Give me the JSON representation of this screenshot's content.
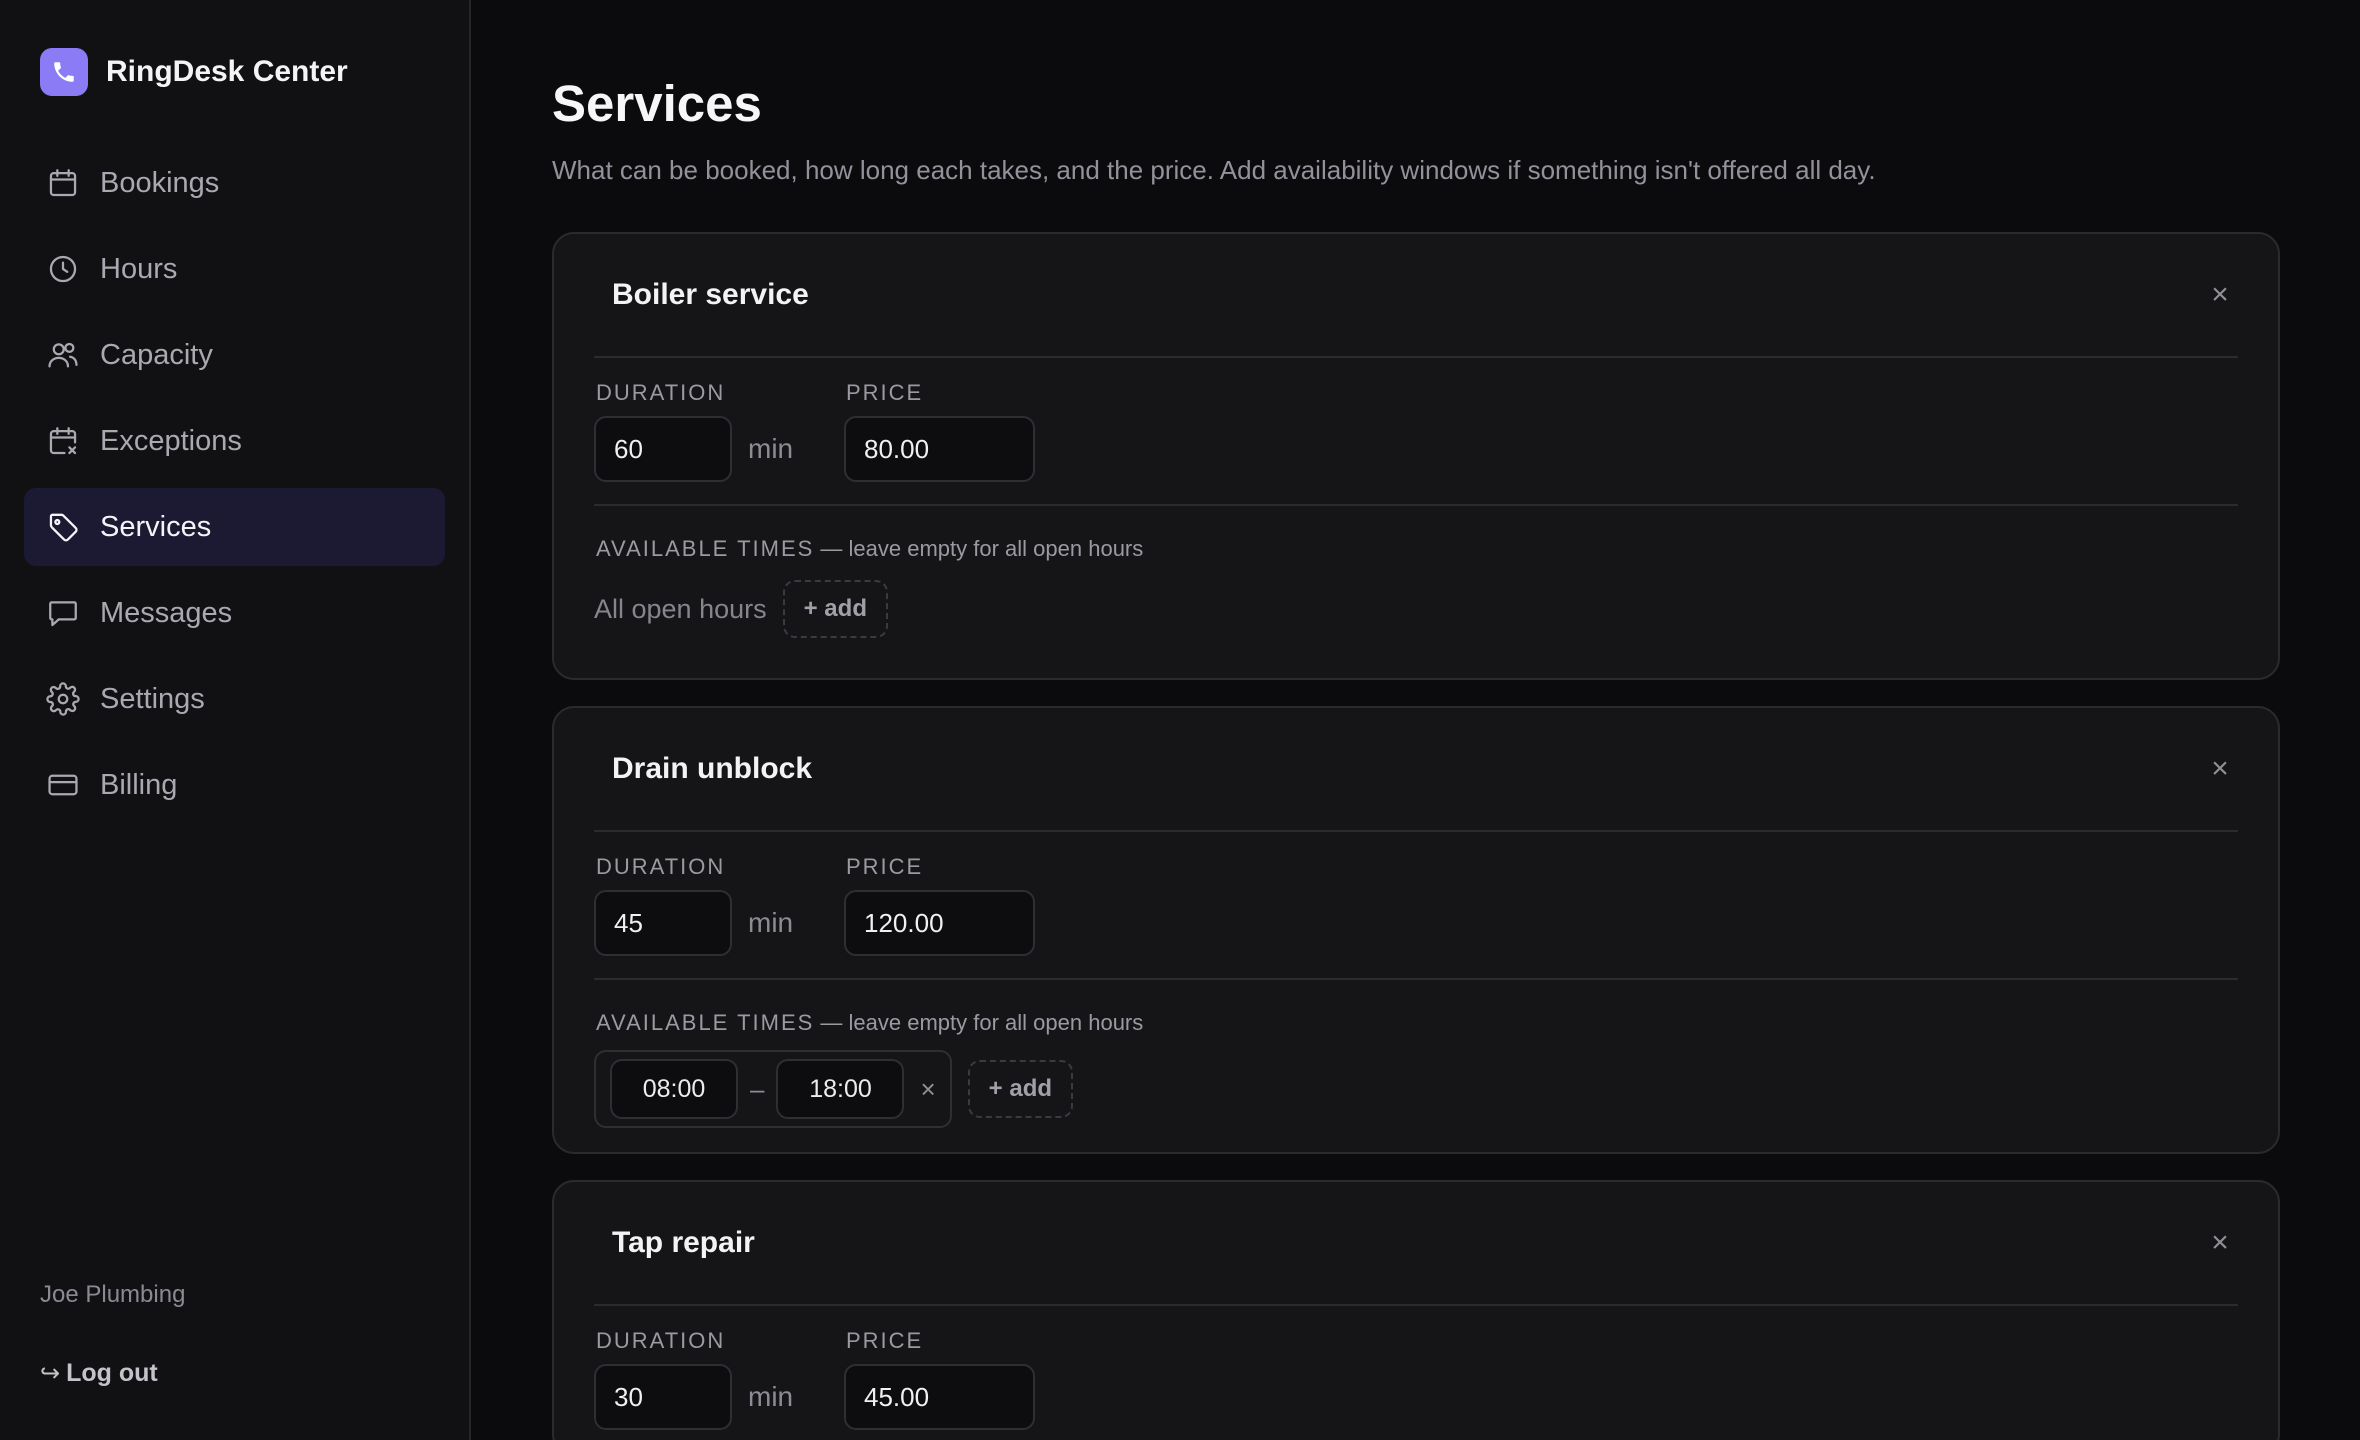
{
  "brand": {
    "name": "RingDesk Center",
    "accent": "#8b7cf6"
  },
  "sidebar": {
    "items": [
      {
        "label": "Bookings",
        "icon": "calendar-icon"
      },
      {
        "label": "Hours",
        "icon": "clock-icon"
      },
      {
        "label": "Capacity",
        "icon": "users-icon"
      },
      {
        "label": "Exceptions",
        "icon": "calendar-x-icon"
      },
      {
        "label": "Services",
        "icon": "tag-icon",
        "active": true
      },
      {
        "label": "Messages",
        "icon": "message-icon"
      },
      {
        "label": "Settings",
        "icon": "gear-icon"
      },
      {
        "label": "Billing",
        "icon": "credit-card-icon"
      }
    ],
    "account_name": "Joe Plumbing",
    "logout_label": "Log out"
  },
  "page": {
    "title": "Services",
    "subtitle": "What can be booked, how long each takes, and the price. Add availability windows if something isn't offered all day."
  },
  "labels": {
    "duration": "DURATION",
    "price": "PRICE",
    "unit_min": "min",
    "available_times": "AVAILABLE TIMES",
    "available_hint": " — leave empty for all open hours",
    "all_open_hours": "All open hours",
    "add": "+ add",
    "close": "×",
    "dash": "–"
  },
  "services": [
    {
      "name": "Boiler service",
      "duration": "60",
      "price": "80.00",
      "windows": []
    },
    {
      "name": "Drain unblock",
      "duration": "45",
      "price": "120.00",
      "windows": [
        {
          "start": "08:00",
          "end": "18:00"
        }
      ]
    },
    {
      "name": "Tap repair",
      "duration": "30",
      "price": "45.00",
      "windows": []
    }
  ]
}
